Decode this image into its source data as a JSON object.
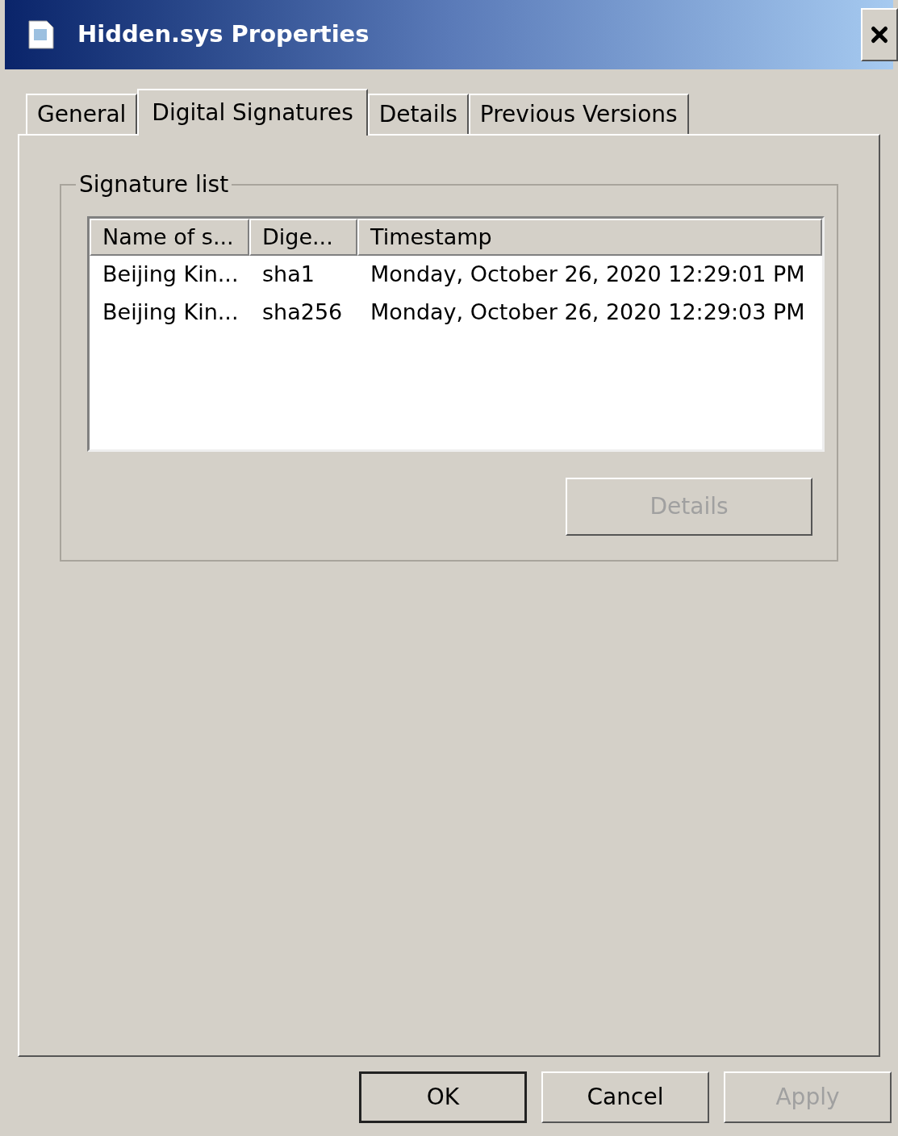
{
  "window": {
    "title": "Hidden.sys Properties"
  },
  "tabs": [
    {
      "label": "General",
      "selected": false
    },
    {
      "label": "Digital Signatures",
      "selected": true
    },
    {
      "label": "Details",
      "selected": false
    },
    {
      "label": "Previous Versions",
      "selected": false
    }
  ],
  "signature_list": {
    "title": "Signature list",
    "columns": [
      "Name of s...",
      "Dige...",
      "Timestamp"
    ],
    "rows": [
      {
        "cells": [
          "Beijing Kin...",
          "sha1",
          "Monday, October 26, 2020 12:29:01 PM"
        ]
      },
      {
        "cells": [
          "Beijing Kin...",
          "sha256",
          "Monday, October 26, 2020 12:29:03 PM"
        ]
      }
    ],
    "details_button": {
      "label": "Details",
      "disabled": true
    }
  },
  "buttons": [
    {
      "label": "OK",
      "disabled": false,
      "default": true
    },
    {
      "label": "Cancel",
      "disabled": false,
      "default": false
    },
    {
      "label": "Apply",
      "disabled": true,
      "default": false
    }
  ]
}
